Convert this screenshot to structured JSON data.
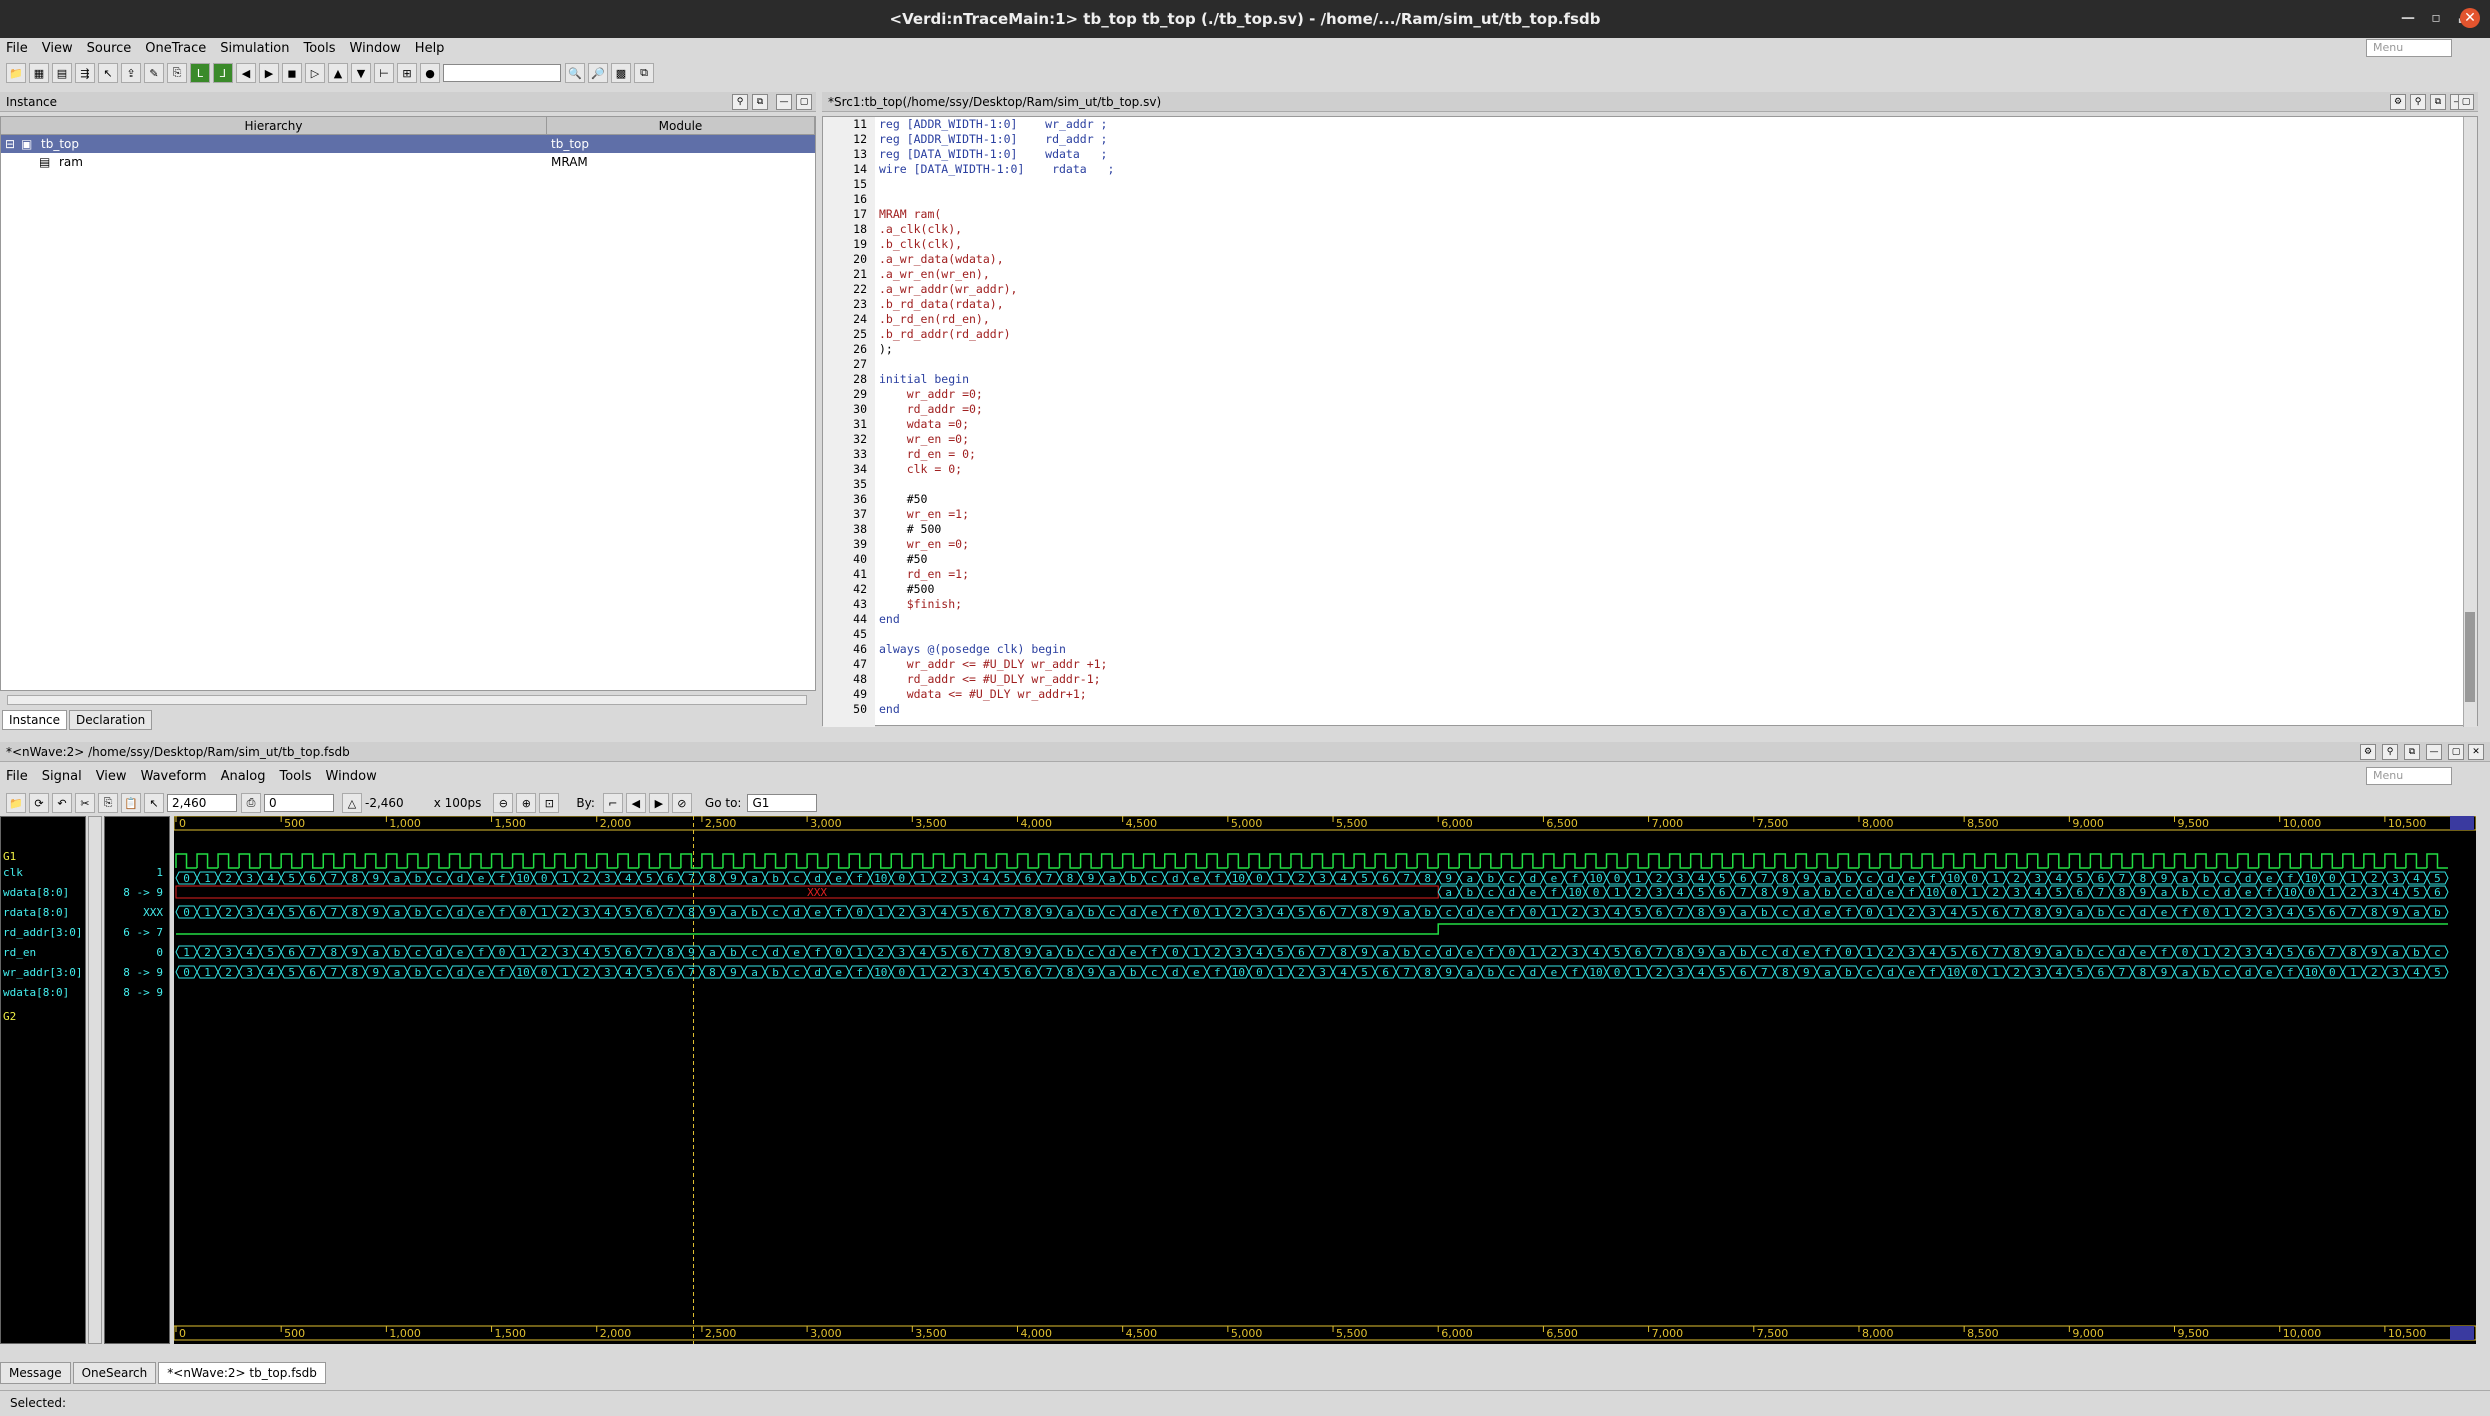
{
  "window": {
    "title": "<Verdi:nTraceMain:1> tb_top tb_top (./tb_top.sv) - /home/.../Ram/sim_ut/tb_top.fsdb"
  },
  "main_menu": [
    "File",
    "View",
    "Source",
    "OneTrace",
    "Simulation",
    "Tools",
    "Window",
    "Help"
  ],
  "menu_search_placeholder": "Menu",
  "instance_panel": {
    "title": "Instance",
    "col_hierarchy": "Hierarchy",
    "col_module": "Module",
    "rows": [
      {
        "name": "tb_top",
        "module": "tb_top",
        "selected": true,
        "indent": 0
      },
      {
        "name": "ram",
        "module": "MRAM",
        "selected": false,
        "indent": 1
      }
    ],
    "tabs": [
      "Instance",
      "Declaration"
    ]
  },
  "source_panel": {
    "title": "*Src1:tb_top(/home/ssy/Desktop/Ram/sim_ut/tb_top.sv)",
    "lines": [
      {
        "n": "11",
        "t": "reg [ADDR_WIDTH-1:0]    wr_addr ;"
      },
      {
        "n": "12",
        "t": "reg [ADDR_WIDTH-1:0]    rd_addr ;"
      },
      {
        "n": "13",
        "t": "reg [DATA_WIDTH-1:0]    wdata   ;"
      },
      {
        "n": "14",
        "t": "wire [DATA_WIDTH-1:0]    rdata   ;"
      },
      {
        "n": "15",
        "t": ""
      },
      {
        "n": "16",
        "t": ""
      },
      {
        "n": "17",
        "t": "MRAM ram("
      },
      {
        "n": "18",
        "t": ".a_clk(clk),"
      },
      {
        "n": "19",
        "t": ".b_clk(clk),"
      },
      {
        "n": "20",
        "t": ".a_wr_data(wdata),"
      },
      {
        "n": "21",
        "t": ".a_wr_en(wr_en),"
      },
      {
        "n": "22",
        "t": ".a_wr_addr(wr_addr),"
      },
      {
        "n": "23",
        "t": ".b_rd_data(rdata),"
      },
      {
        "n": "24",
        "t": ".b_rd_en(rd_en),"
      },
      {
        "n": "25",
        "t": ".b_rd_addr(rd_addr)"
      },
      {
        "n": "26",
        "t": ");"
      },
      {
        "n": "27",
        "t": ""
      },
      {
        "n": "28",
        "t": "initial begin"
      },
      {
        "n": "29",
        "t": "    wr_addr =0;"
      },
      {
        "n": "30",
        "t": "    rd_addr =0;"
      },
      {
        "n": "31",
        "t": "    wdata =0;"
      },
      {
        "n": "32",
        "t": "    wr_en =0;"
      },
      {
        "n": "33",
        "t": "    rd_en = 0;"
      },
      {
        "n": "34",
        "t": "    clk = 0;"
      },
      {
        "n": "35",
        "t": ""
      },
      {
        "n": "36",
        "t": "    #50"
      },
      {
        "n": "37",
        "t": "    wr_en =1;"
      },
      {
        "n": "38",
        "t": "    # 500"
      },
      {
        "n": "39",
        "t": "    wr_en =0;"
      },
      {
        "n": "40",
        "t": "    #50"
      },
      {
        "n": "41",
        "t": "    rd_en =1;"
      },
      {
        "n": "42",
        "t": "    #500"
      },
      {
        "n": "43",
        "t": "    $finish;"
      },
      {
        "n": "44",
        "t": "end"
      },
      {
        "n": "45",
        "t": ""
      },
      {
        "n": "46",
        "t": "always @(posedge clk) begin"
      },
      {
        "n": "47",
        "t": "    wr_addr <= #U_DLY wr_addr +1;"
      },
      {
        "n": "48",
        "t": "    rd_addr <= #U_DLY wr_addr-1;"
      },
      {
        "n": "49",
        "t": "    wdata <= #U_DLY wr_addr+1;"
      },
      {
        "n": "50",
        "t": "end"
      }
    ]
  },
  "wave_panel": {
    "title": "*<nWave:2> /home/ssy/Desktop/Ram/sim_ut/tb_top.fsdb",
    "menu": [
      "File",
      "Signal",
      "View",
      "Waveform",
      "Analog",
      "Tools",
      "Window"
    ],
    "cursor_time": "2,460",
    "marker_time": "0",
    "delta": "-2,460",
    "unit": "x 100ps",
    "by_label": "By:",
    "goto_label": "Go to:",
    "goto_value": "G1",
    "group1": "G1",
    "group2": "G2",
    "signals": [
      {
        "name": "clk",
        "value": "1"
      },
      {
        "name": "wdata[8:0]",
        "value": "8 -> 9"
      },
      {
        "name": "rdata[8:0]",
        "value": "XXX"
      },
      {
        "name": "rd_addr[3:0]",
        "value": "6 -> 7"
      },
      {
        "name": "rd_en",
        "value": "0"
      },
      {
        "name": "wr_addr[3:0]",
        "value": "8 -> 9"
      },
      {
        "name": "wdata[8:0]",
        "value": "8 -> 9"
      }
    ],
    "ruler_ticks": [
      "0",
      "500",
      "1,000",
      "1,500",
      "2,000",
      "2,500",
      "3,000",
      "3,500",
      "4,000",
      "4,500",
      "5,000",
      "5,500",
      "6,000",
      "6,500",
      "7,000",
      "7,500",
      "8,000",
      "8,500",
      "9,000",
      "9,500",
      "10,000",
      "10,500"
    ],
    "xxx_label": "XXX",
    "colors": {
      "wave": "#22dd44",
      "bus": "#33e0e0",
      "xxx": "#e02020",
      "cursor": "#e0c030"
    }
  },
  "bottom_tabs": [
    "Message",
    "OneSearch",
    "*<nWave:2> tb_top.fsdb"
  ],
  "status": "Selected:"
}
